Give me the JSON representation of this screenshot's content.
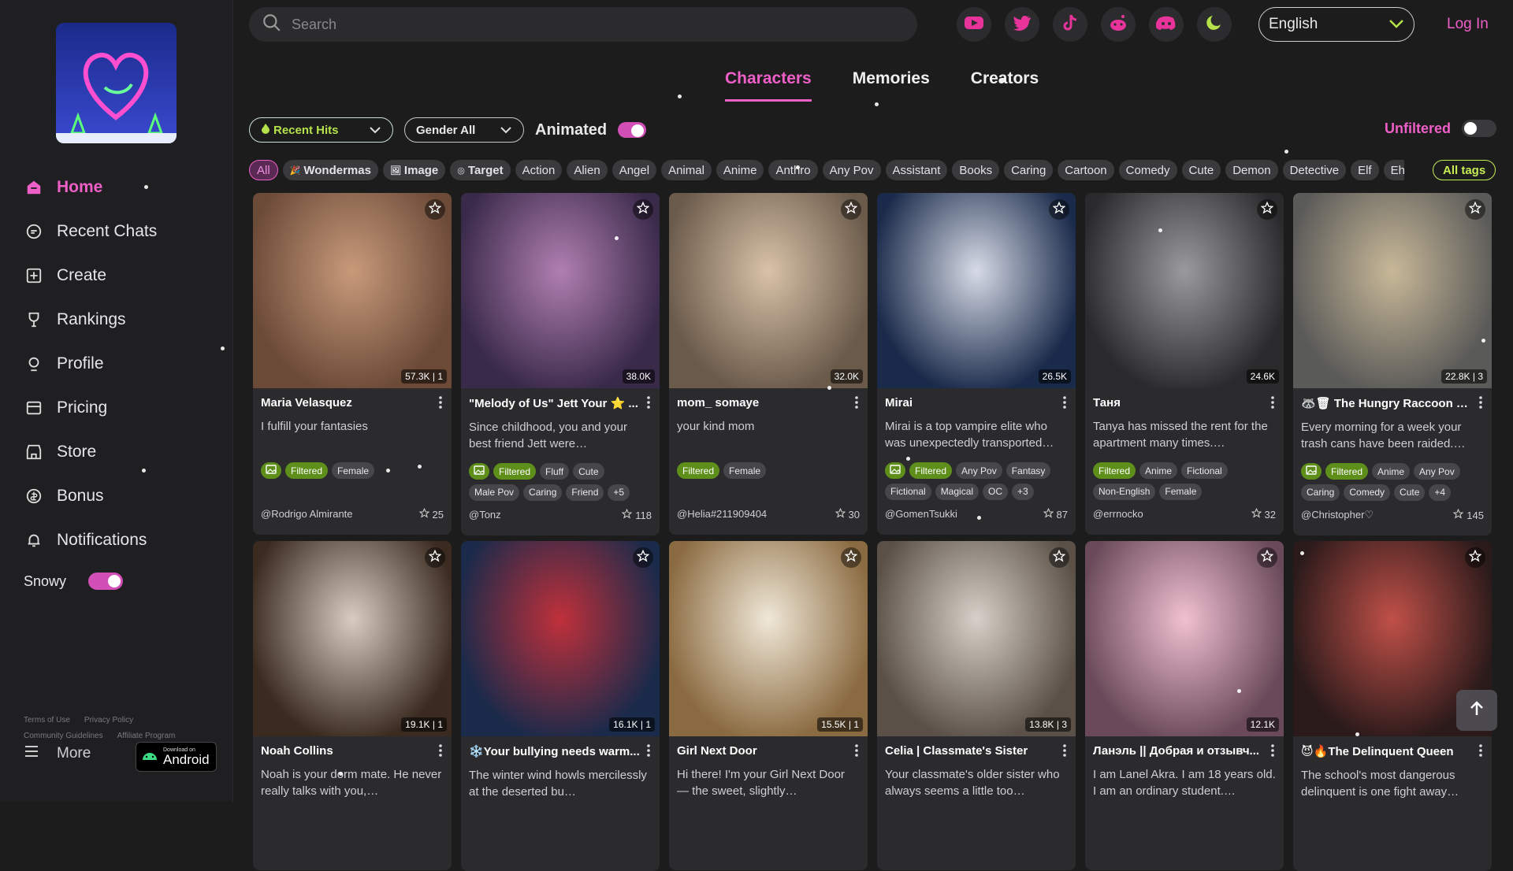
{
  "search": {
    "placeholder": "Search"
  },
  "language": {
    "selected": "English"
  },
  "auth": {
    "login_label": "Log In"
  },
  "social_icons": [
    "youtube-icon",
    "twitter-icon",
    "tiktok-icon",
    "reddit-icon",
    "discord-icon",
    "moon-icon"
  ],
  "tabs": [
    {
      "label": "Characters",
      "active": true
    },
    {
      "label": "Memories",
      "active": false
    },
    {
      "label": "Creators",
      "active": false
    }
  ],
  "filters": {
    "sort": "Recent Hits",
    "gender": "Gender All",
    "animated_label": "Animated",
    "animated_on": true,
    "unfiltered_label": "Unfiltered",
    "unfiltered_on": false
  },
  "tags": [
    "All",
    "Wondermas",
    "Image",
    "Target",
    "Action",
    "Alien",
    "Angel",
    "Animal",
    "Anime",
    "Anthro",
    "Any Pov",
    "Assistant",
    "Books",
    "Caring",
    "Cartoon",
    "Comedy",
    "Cute",
    "Demon",
    "Detective",
    "Elf",
    "Eh"
  ],
  "all_tags_label": "All tags",
  "sidebar": {
    "items": [
      {
        "label": "Home",
        "icon": "home-icon",
        "active": true
      },
      {
        "label": "Recent Chats",
        "icon": "chat-icon",
        "active": false
      },
      {
        "label": "Create",
        "icon": "plus-square-icon",
        "active": false
      },
      {
        "label": "Rankings",
        "icon": "trophy-icon",
        "active": false
      },
      {
        "label": "Profile",
        "icon": "profile-icon",
        "active": false
      },
      {
        "label": "Pricing",
        "icon": "card-icon",
        "active": false
      },
      {
        "label": "Store",
        "icon": "store-icon",
        "active": false
      },
      {
        "label": "Bonus",
        "icon": "coin-icon",
        "active": false
      },
      {
        "label": "Notifications",
        "icon": "bell-icon",
        "active": false
      }
    ],
    "snowy_label": "Snowy",
    "snowy_on": true,
    "footer_links": [
      "Terms of Use",
      "Privacy Policy",
      "Community Guidelines",
      "Affiliate Program"
    ],
    "more_label": "More",
    "android_small": "Download on",
    "android_big": "Android"
  },
  "colors": {
    "accent": "#ef5fc8",
    "green": "#b5e24a",
    "filtered": "#5e8f1a",
    "bg": "#1c1c1d"
  },
  "cards": [
    {
      "title": "Maria Velasquez",
      "desc": "I fulfill your fantasies",
      "stats": "57.3K | 1",
      "chips": [
        "img",
        "Filtered",
        "Female"
      ],
      "author": "@Rodrigo Almirante",
      "stars": "25",
      "c1": "#6b4a38",
      "c2": "#c89a7a"
    },
    {
      "title": "\"Melody of Us\" Jett Your ⭐ ...",
      "desc": "Since childhood, you and your best friend Jett were…",
      "stats": "38.0K",
      "chips": [
        "img",
        "Filtered",
        "Fluff",
        "Cute",
        "Male Pov",
        "Caring",
        "Friend",
        "+5"
      ],
      "author": "@Tonz",
      "stars": "118",
      "c1": "#3a2a4a",
      "c2": "#b07fb0"
    },
    {
      "title": "mom_ somaye",
      "desc": "your kind mom",
      "stats": "32.0K",
      "chips": [
        "Filtered",
        "Female"
      ],
      "author": "@Helia#211909404",
      "stars": "30",
      "c1": "#6a5a4a",
      "c2": "#d8c2a8"
    },
    {
      "title": "Mirai",
      "desc": "Mirai is a top vampire elite who was unexpectedly transported…",
      "stats": "26.5K",
      "chips": [
        "img",
        "Filtered",
        "Any Pov",
        "Fantasy",
        "Fictional",
        "Magical",
        "OC",
        "+3"
      ],
      "author": "@GomenTsukki",
      "stars": "87",
      "c1": "#1a2a4a",
      "c2": "#d6dbe6"
    },
    {
      "title": "Таня",
      "desc": "Tanya has missed the rent for the apartment many times.…",
      "stats": "24.6K",
      "chips": [
        "Filtered",
        "Anime",
        "Fictional",
        "Non-English",
        "Female"
      ],
      "author": "@errnocko",
      "stars": "32",
      "c1": "#2a2a2c",
      "c2": "#9a9a9c"
    },
    {
      "title": "🦝🗑 The Hungry Raccoon G...",
      "desc": "Every morning for a week your trash cans have been raided.…",
      "stats": "22.8K | 3",
      "chips": [
        "img",
        "Filtered",
        "Anime",
        "Any Pov",
        "Caring",
        "Comedy",
        "Cute",
        "+4"
      ],
      "author": "@Christopher♡",
      "stars": "145",
      "c1": "#5a5a58",
      "c2": "#c8b898"
    },
    {
      "title": "Noah Collins",
      "desc": "Noah is your dorm mate. He never really talks with you,…",
      "stats": "19.1K | 1",
      "chips": [],
      "author": "",
      "stars": "",
      "c1": "#3a2a20",
      "c2": "#d8ccc0"
    },
    {
      "title": "❄️Your bullying needs warm...",
      "desc": "The winter wind howls mercilessly at the deserted bu…",
      "stats": "16.1K | 1",
      "chips": [],
      "author": "",
      "stars": "",
      "c1": "#1a2a4a",
      "c2": "#c0303a"
    },
    {
      "title": "Girl Next Door",
      "desc": "Hi there! I'm your Girl Next Door — the sweet, slightly…",
      "stats": "15.5K | 1",
      "chips": [],
      "author": "",
      "stars": "",
      "c1": "#8a6a40",
      "c2": "#f0e8d8"
    },
    {
      "title": "Celia | Classmate's Sister",
      "desc": "Your classmate's older sister who always seems a little too…",
      "stats": "13.8K | 3",
      "chips": [],
      "author": "",
      "stars": "",
      "c1": "#5a5048",
      "c2": "#d8d0c8"
    },
    {
      "title": "Ланэль || Добрая и отзывч...",
      "desc": "I am Lanel Akra. I am 18 years old. I am an ordinary student.…",
      "stats": "12.1K",
      "chips": [],
      "author": "",
      "stars": "",
      "c1": "#6a4a5a",
      "c2": "#f0c0d0"
    },
    {
      "title": "😈🔥The Delinquent Queen",
      "desc": "The school's most dangerous delinquent is one fight away…",
      "stats": "",
      "chips": [],
      "author": "",
      "stars": "",
      "c1": "#2a1a1a",
      "c2": "#c05048"
    }
  ]
}
